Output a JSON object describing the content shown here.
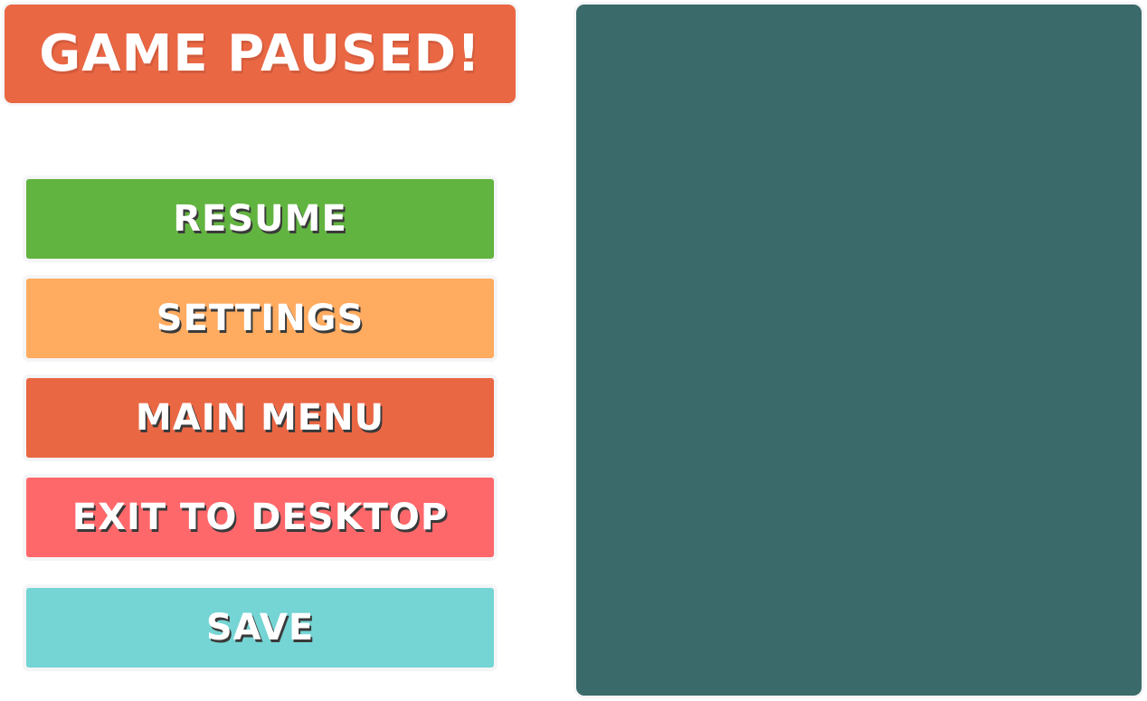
{
  "title": {
    "text": "GAME PAUSED!",
    "color": "#EA6744"
  },
  "menu": {
    "resume": {
      "label": "RESUME",
      "color": "#62B440"
    },
    "settings": {
      "label": "SETTINGS",
      "color": "#FFAB60"
    },
    "main_menu": {
      "label": "MAIN MENU",
      "color": "#EA6744"
    },
    "exit": {
      "label": "EXIT TO DESKTOP",
      "color": "#FF686B"
    },
    "save": {
      "label": "SAVE",
      "color": "#74D5D4"
    }
  },
  "preview": {
    "color": "#3A6A69"
  }
}
